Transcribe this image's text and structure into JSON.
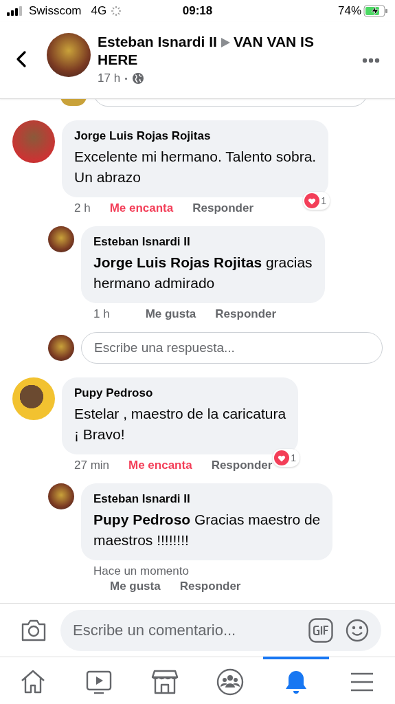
{
  "status_bar": {
    "carrier": "Swisscom",
    "network": "4G",
    "time": "09:18",
    "battery": "74%",
    "charging": true
  },
  "header": {
    "author": "Esteban Isnardi II",
    "group": "VAN VAN IS HERE",
    "time": "17 h"
  },
  "comments": [
    {
      "author": "Jorge Luis Rojas Rojitas",
      "text": "Excelente mi hermano. Talento sobra.\nUn abrazo",
      "time": "2 h",
      "like_label": "Me encanta",
      "reacted": true,
      "reply_label": "Responder",
      "reaction_count": "1",
      "replies": [
        {
          "author": "Esteban Isnardi II",
          "text": "**Jorge Luis Rojas Rojitas** gracias\nhermano admirado",
          "time": "1 h",
          "like_label": "Me gusta",
          "reacted": false,
          "reply_label": "Responder"
        }
      ],
      "reply_box": {
        "placeholder": "Escribe una respuesta..."
      }
    },
    {
      "author": "Pupy Pedroso",
      "text": "Estelar , maestro de la caricatura\n¡ Bravo!",
      "time": "27 min",
      "like_label": "Me encanta",
      "reacted": true,
      "reply_label": "Responder",
      "reaction_count": "1",
      "replies": [
        {
          "author": "Esteban Isnardi II",
          "text": "**Pupy Pedroso** Gracias maestro de\nmaestros !!!!!!!!",
          "time": "Hace un momento",
          "like_label": "Me gusta",
          "reacted": false,
          "reply_label": "Responder"
        }
      ]
    }
  ],
  "composer": {
    "placeholder": "Escribe un comentario..."
  },
  "tabs": [
    {
      "kind": "home",
      "selected": false
    },
    {
      "kind": "video",
      "selected": false
    },
    {
      "kind": "marketplace",
      "selected": false
    },
    {
      "kind": "groups",
      "selected": false
    },
    {
      "kind": "notifications",
      "selected": true
    },
    {
      "kind": "menu",
      "selected": false
    }
  ]
}
